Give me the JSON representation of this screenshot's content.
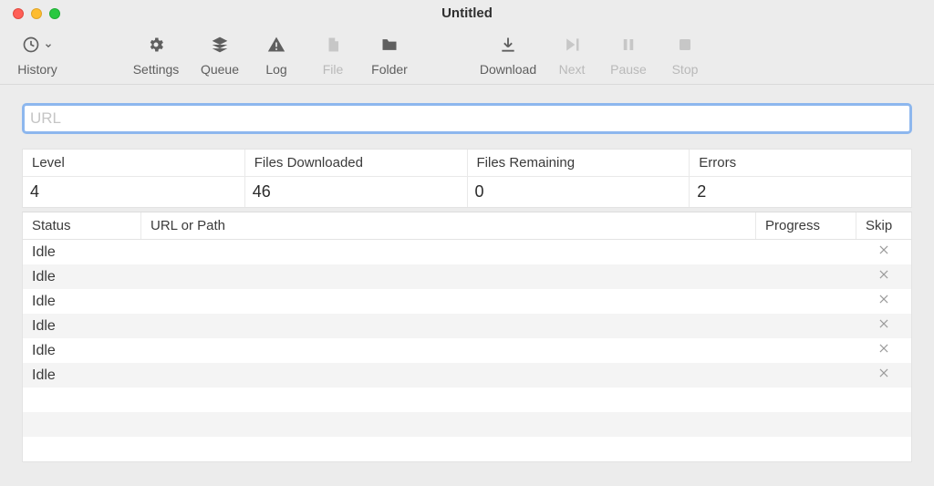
{
  "window": {
    "title": "Untitled"
  },
  "toolbar": {
    "history": {
      "label": "History"
    },
    "settings": {
      "label": "Settings"
    },
    "queue": {
      "label": "Queue"
    },
    "log": {
      "label": "Log"
    },
    "file": {
      "label": "File"
    },
    "folder": {
      "label": "Folder"
    },
    "download": {
      "label": "Download"
    },
    "next": {
      "label": "Next"
    },
    "pause": {
      "label": "Pause"
    },
    "stop": {
      "label": "Stop"
    }
  },
  "url_field": {
    "placeholder": "URL",
    "value": ""
  },
  "stats": {
    "headers": {
      "level": "Level",
      "downloaded": "Files Downloaded",
      "remaining": "Files Remaining",
      "errors": "Errors"
    },
    "values": {
      "level": "4",
      "downloaded": "46",
      "remaining": "0",
      "errors": "2"
    }
  },
  "file_table": {
    "headers": {
      "status": "Status",
      "url": "URL or Path",
      "progress": "Progress",
      "skip": "Skip"
    },
    "rows": [
      {
        "status": "Idle",
        "url": "",
        "progress": "",
        "skip": true
      },
      {
        "status": "Idle",
        "url": "",
        "progress": "",
        "skip": true
      },
      {
        "status": "Idle",
        "url": "",
        "progress": "",
        "skip": true
      },
      {
        "status": "Idle",
        "url": "",
        "progress": "",
        "skip": true
      },
      {
        "status": "Idle",
        "url": "",
        "progress": "",
        "skip": true
      },
      {
        "status": "Idle",
        "url": "",
        "progress": "",
        "skip": true
      },
      {
        "status": "",
        "url": "",
        "progress": "",
        "skip": false
      },
      {
        "status": "",
        "url": "",
        "progress": "",
        "skip": false
      },
      {
        "status": "",
        "url": "",
        "progress": "",
        "skip": false
      }
    ]
  }
}
